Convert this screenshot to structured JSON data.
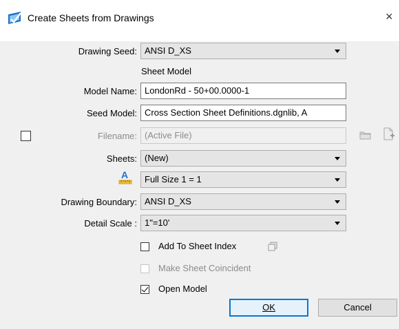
{
  "window": {
    "title": "Create Sheets from Drawings",
    "close_glyph": "×"
  },
  "form": {
    "drawing_seed": {
      "label": "Drawing Seed:",
      "value": "ANSI D_XS"
    },
    "section_heading": "Sheet Model",
    "model_name": {
      "label": "Model Name:",
      "value": "LondonRd - 50+00.0000-1"
    },
    "seed_model": {
      "label": "Seed Model:",
      "value": "Cross Section Sheet Definitions.dgnlib, A"
    },
    "filename": {
      "label": "Filename:",
      "value": "(Active File)",
      "enabled": false
    },
    "sheets": {
      "label": "Sheets:",
      "value": "(New)"
    },
    "annotation_scale": {
      "value": "Full Size 1 = 1"
    },
    "drawing_boundary": {
      "label": "Drawing Boundary:",
      "value": "ANSI D_XS"
    },
    "detail_scale": {
      "label": "Detail Scale :",
      "value": "1\"=10'"
    }
  },
  "options": {
    "add_to_sheet_index": {
      "label": "Add To Sheet Index",
      "checked": false
    },
    "make_sheet_coincident": {
      "label": "Make Sheet Coincident",
      "checked": false,
      "enabled": false
    },
    "open_model": {
      "label": "Open Model",
      "checked": true
    }
  },
  "buttons": {
    "ok": "OK",
    "cancel": "Cancel"
  },
  "icons": {
    "title": "create-sheets-icon",
    "folder": "folder-icon",
    "new_file": "new-file-icon",
    "annotation_scale": "annotation-scale-icon",
    "sheet_index": "sheet-index-icon"
  },
  "colors": {
    "accent": "#0078d7",
    "annotation_icon": "#1f6fd1",
    "annotation_underline": "#d9a000"
  }
}
